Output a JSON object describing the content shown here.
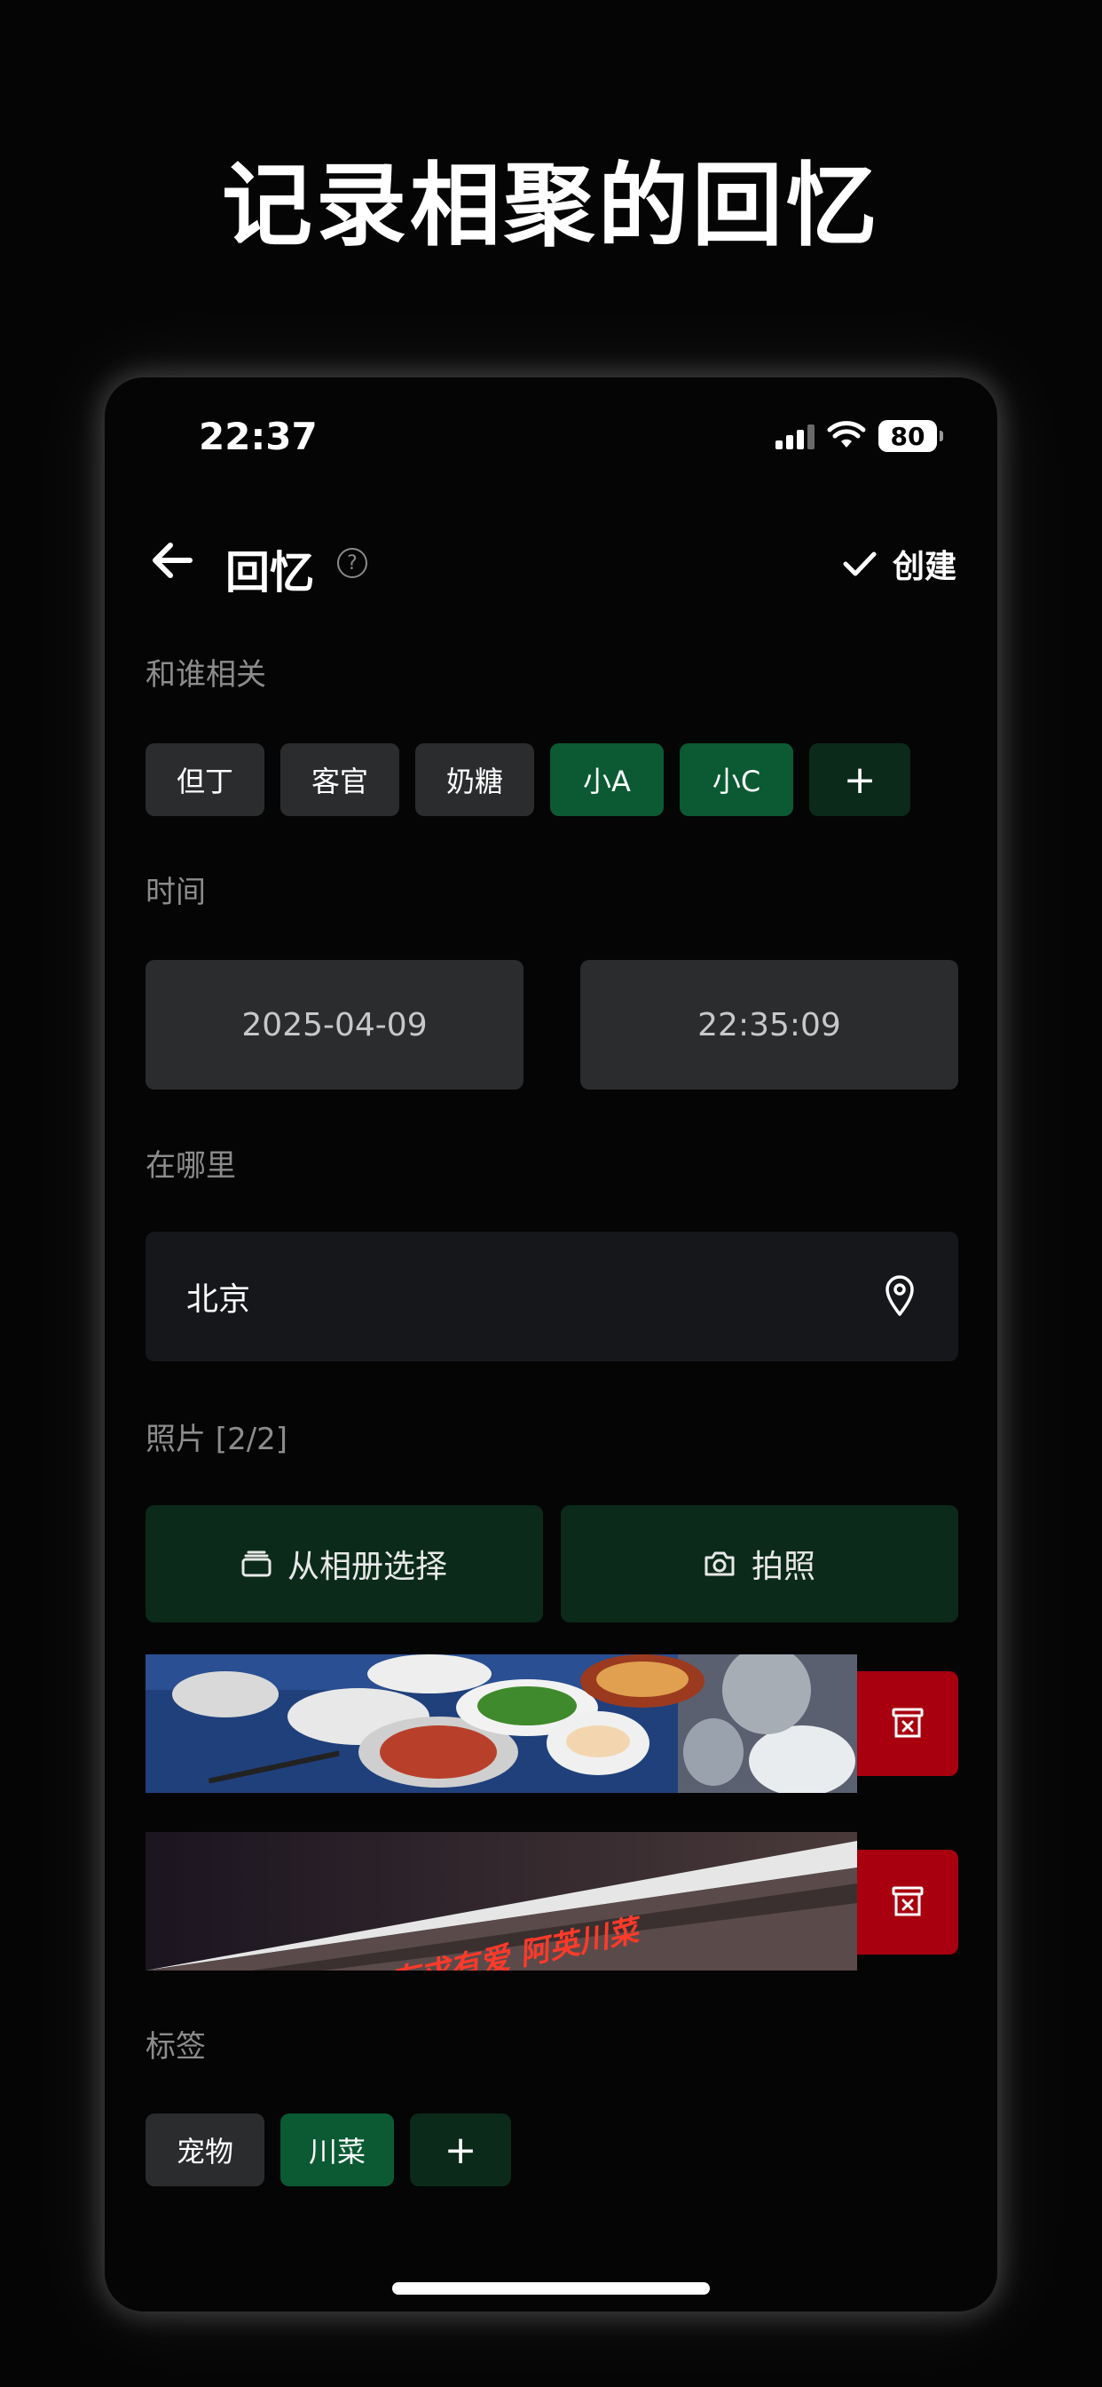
{
  "headline": "记录相聚的回忆",
  "status_bar": {
    "time": "22:37",
    "battery": "80"
  },
  "nav": {
    "title": "回忆",
    "help": "?",
    "create_label": "创建"
  },
  "who": {
    "label": "和谁相关",
    "chips": [
      {
        "label": "但丁",
        "selected": false
      },
      {
        "label": "客官",
        "selected": false
      },
      {
        "label": "奶糖",
        "selected": false
      },
      {
        "label": "小A",
        "selected": true
      },
      {
        "label": "小C",
        "selected": true
      }
    ],
    "add": "+"
  },
  "time": {
    "label": "时间",
    "date": "2025-04-09",
    "clock": "22:35:09"
  },
  "where": {
    "label": "在哪里",
    "value": "北京"
  },
  "photos": {
    "label": "照片 [2/2]",
    "album_button": "从相册选择",
    "camera_button": "拍照",
    "photo2_sign_text": "有求有爱 阿英川菜"
  },
  "tags": {
    "label": "标签",
    "chips": [
      {
        "label": "宠物",
        "selected": false
      },
      {
        "label": "川菜",
        "selected": true
      }
    ],
    "add": "+"
  },
  "colors": {
    "background": "#050505",
    "chip": "#2b2c2e",
    "chip_selected": "#0b5a33",
    "chip_add": "#0b2a1a",
    "delete": "#a8000f"
  }
}
